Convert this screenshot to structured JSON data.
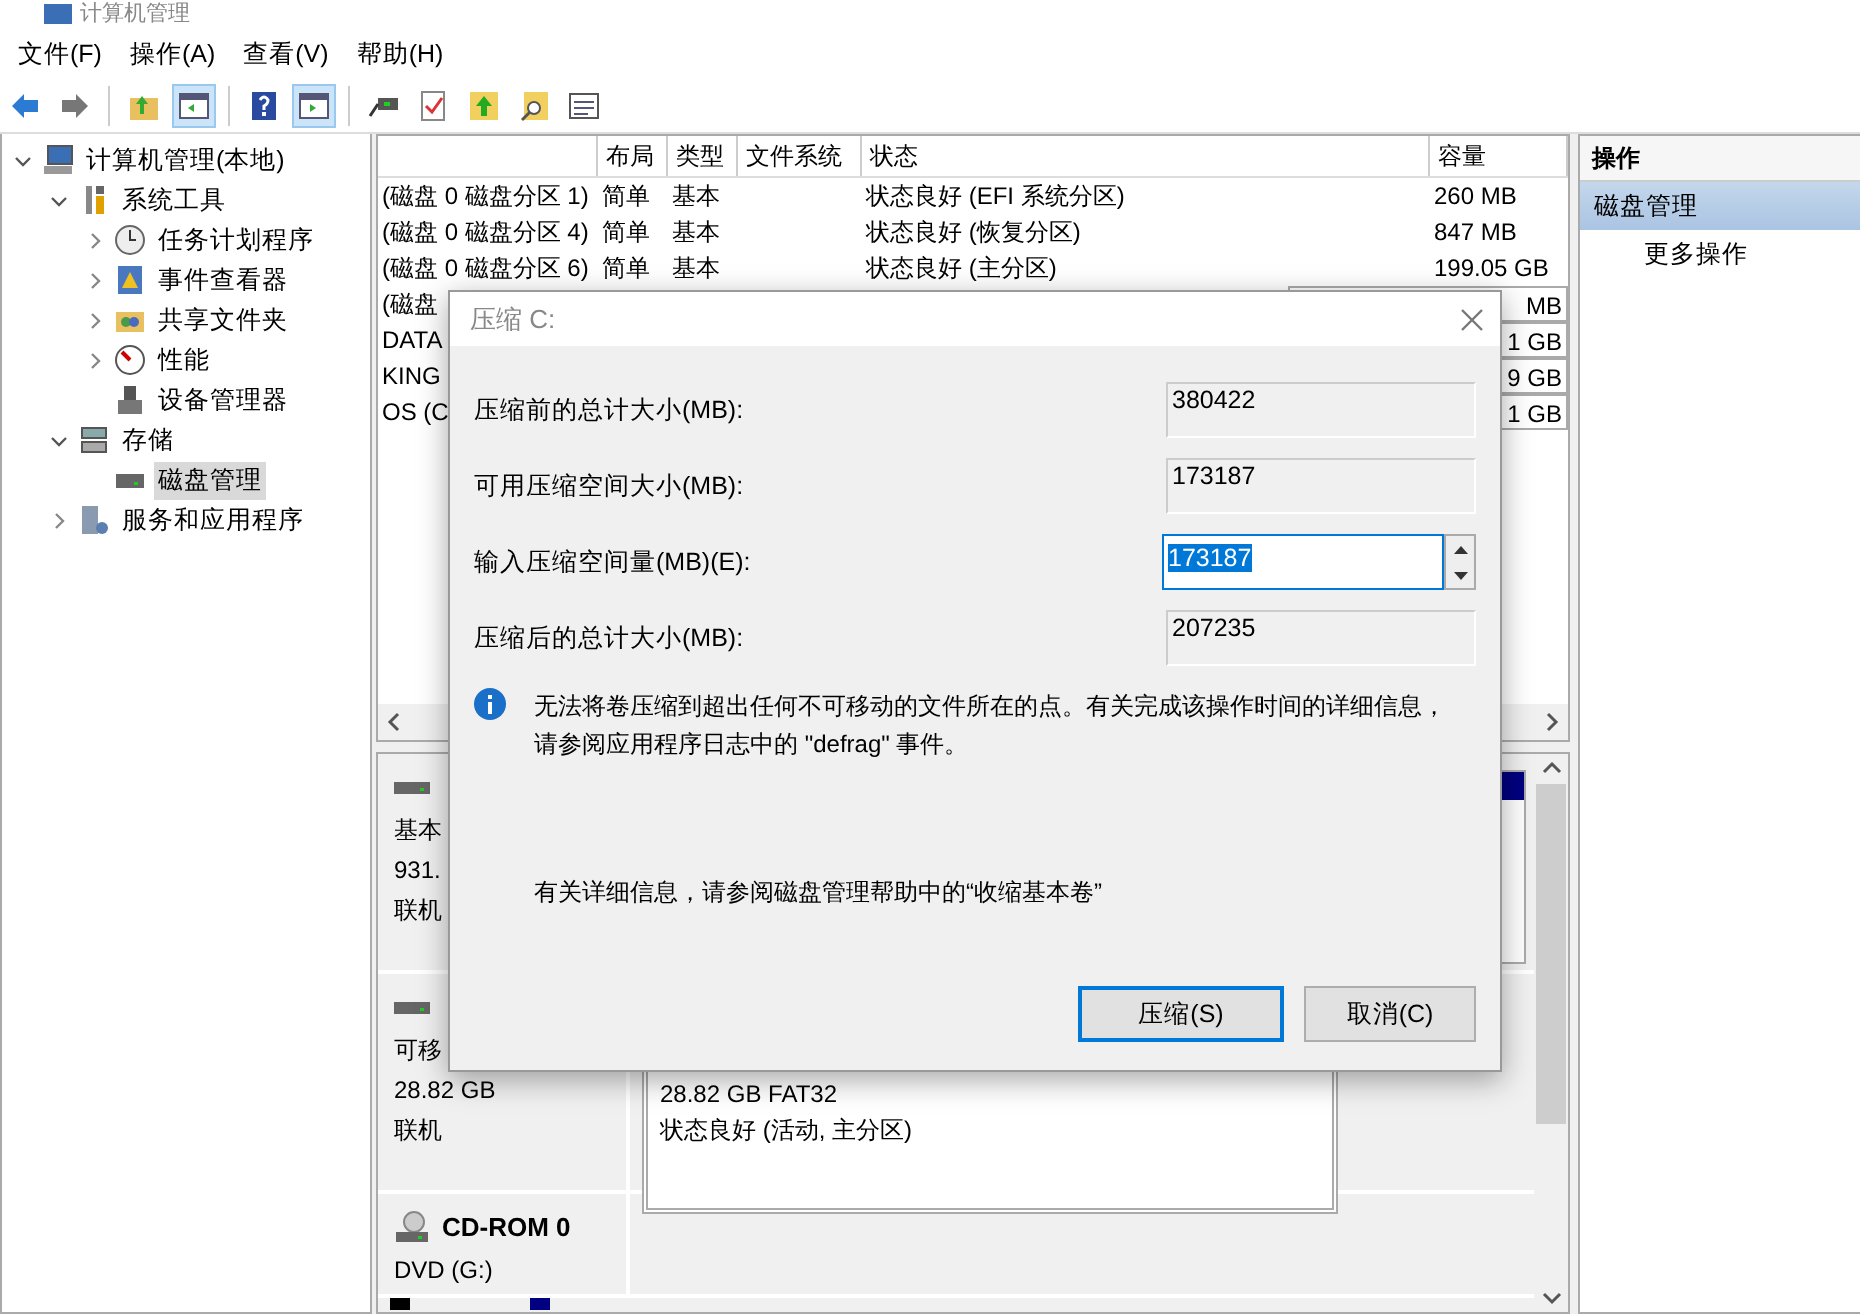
{
  "window": {
    "title": "计算机管理"
  },
  "menu": [
    "文件(F)",
    "操作(A)",
    "查看(V)",
    "帮助(H)"
  ],
  "toolbar": [
    {
      "kind": "back",
      "selected": false
    },
    {
      "kind": "forward",
      "selected": false
    },
    {
      "kind": "sep"
    },
    {
      "kind": "up",
      "selected": false
    },
    {
      "kind": "pane",
      "selected": true
    },
    {
      "kind": "sep"
    },
    {
      "kind": "help",
      "selected": false
    },
    {
      "kind": "pane2",
      "selected": true
    },
    {
      "kind": "sep"
    },
    {
      "kind": "connect",
      "selected": false
    },
    {
      "kind": "check",
      "selected": false
    },
    {
      "kind": "export",
      "selected": false
    },
    {
      "kind": "find",
      "selected": false
    },
    {
      "kind": "list",
      "selected": false
    }
  ],
  "tree": [
    {
      "label": "计算机管理(本地)",
      "expanded": true,
      "selected": false,
      "children": [
        {
          "label": "系统工具",
          "expanded": true,
          "selected": false,
          "children": [
            {
              "label": "任务计划程序",
              "expanded": false,
              "selected": false
            },
            {
              "label": "事件查看器",
              "expanded": false,
              "selected": false
            },
            {
              "label": "共享文件夹",
              "expanded": false,
              "selected": false
            },
            {
              "label": "性能",
              "expanded": false,
              "selected": false
            },
            {
              "label": "设备管理器",
              "selected": false
            }
          ]
        },
        {
          "label": "存储",
          "expanded": true,
          "selected": false,
          "children": [
            {
              "label": "磁盘管理",
              "selected": true
            }
          ]
        },
        {
          "label": "服务和应用程序",
          "expanded": false,
          "selected": false
        }
      ]
    }
  ],
  "table": {
    "columns": [
      "",
      "布局",
      "类型",
      "文件系统",
      "状态",
      "容量"
    ],
    "rows": [
      {
        "kind": "full",
        "cells": [
          "(磁盘 0 磁盘分区 1)",
          "简单",
          "基本",
          "",
          "状态良好 (EFI 系统分区)",
          "260 MB"
        ]
      },
      {
        "kind": "full",
        "cells": [
          "(磁盘 0 磁盘分区 4)",
          "简单",
          "基本",
          "",
          "状态良好 (恢复分区)",
          "847 MB"
        ]
      },
      {
        "kind": "full",
        "cells": [
          "(磁盘 0 磁盘分区 6)",
          "简单",
          "基本",
          "",
          "状态良好 (主分区)",
          "199.05 GB"
        ]
      },
      {
        "kind": "partial",
        "name": "(磁盘",
        "capacity": "MB"
      },
      {
        "kind": "partial",
        "name": "DATA",
        "capacity": "1 GB"
      },
      {
        "kind": "partial",
        "name": "KING",
        "capacity": "9 GB"
      },
      {
        "kind": "partial",
        "name": "OS (C",
        "capacity": "1 GB"
      }
    ]
  },
  "disks": [
    {
      "kind": "disk",
      "lines": [
        "基本",
        "931.",
        "联机"
      ]
    },
    {
      "kind": "removable",
      "lines": [
        "可移",
        "28.82 GB",
        "联机"
      ],
      "volume": [
        "28.82 GB FAT32",
        "状态良好 (活动, 主分区)"
      ]
    },
    {
      "kind": "cdrom",
      "title": "CD-ROM 0",
      "lines": [
        "DVD (G:)"
      ]
    }
  ],
  "actions": {
    "title": "操作",
    "section": "磁盘管理",
    "items": [
      "更多操作"
    ]
  },
  "dialog": {
    "title": "压缩 C:",
    "fields": [
      {
        "kind": "readonly",
        "label": "压缩前的总计大小(MB):",
        "value": "380422"
      },
      {
        "kind": "readonly",
        "label": "可用压缩空间大小(MB):",
        "value": "173187"
      },
      {
        "kind": "spin",
        "label": "输入压缩空间量(MB)(E):",
        "value": "173187"
      },
      {
        "kind": "readonly",
        "label": "压缩后的总计大小(MB):",
        "value": "207235"
      }
    ],
    "info": "无法将卷压缩到超出任何不可移动的文件所在的点。有关完成该操作时间的详细信息，请参阅应用程序日志中的 \"defrag\" 事件。",
    "help": "有关详细信息，请参阅磁盘管理帮助中的“收缩基本卷”",
    "buttons": [
      {
        "label": "压缩(S)",
        "default": true
      },
      {
        "label": "取消(C)",
        "default": false
      }
    ]
  }
}
